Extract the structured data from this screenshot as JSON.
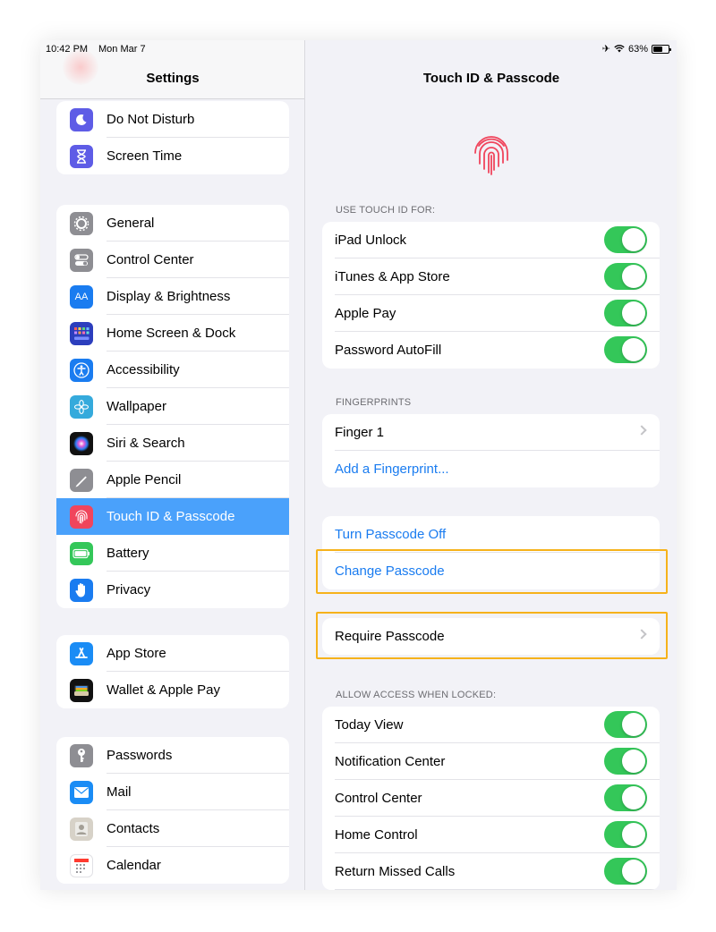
{
  "status": {
    "time": "10:42 PM",
    "date": "Mon Mar 7",
    "battery": "63%",
    "battery_level": 0.63
  },
  "sidebar": {
    "title": "Settings",
    "groups": [
      {
        "items": [
          {
            "label": "Do Not Disturb",
            "icon": "moon-icon",
            "color": "#5e5ce6"
          },
          {
            "label": "Screen Time",
            "icon": "hourglass-icon",
            "color": "#5e5ce6"
          }
        ]
      },
      {
        "items": [
          {
            "label": "General",
            "icon": "gear-icon",
            "color": "#8e8e93"
          },
          {
            "label": "Control Center",
            "icon": "switches-icon",
            "color": "#8e8e93"
          },
          {
            "label": "Display & Brightness",
            "icon": "display-aa-icon",
            "color": "#1a7cf0"
          },
          {
            "label": "Home Screen & Dock",
            "icon": "home-grid-icon",
            "color": "#2c3ebd"
          },
          {
            "label": "Accessibility",
            "icon": "accessibility-icon",
            "color": "#1a7cf0"
          },
          {
            "label": "Wallpaper",
            "icon": "flower-icon",
            "color": "#35aadc"
          },
          {
            "label": "Siri & Search",
            "icon": "siri-icon",
            "color": "#111111"
          },
          {
            "label": "Apple Pencil",
            "icon": "pencil-icon",
            "color": "#8e8e93"
          },
          {
            "label": "Touch ID & Passcode",
            "icon": "fingerprint-icon",
            "color": "#f0455c",
            "selected": true
          },
          {
            "label": "Battery",
            "icon": "battery-icon",
            "color": "#34c759"
          },
          {
            "label": "Privacy",
            "icon": "hand-icon",
            "color": "#1a7cf0"
          }
        ]
      },
      {
        "items": [
          {
            "label": "App Store",
            "icon": "app-store-icon",
            "color": "#1a8cf5"
          },
          {
            "label": "Wallet & Apple Pay",
            "icon": "wallet-icon",
            "color": "#111111"
          }
        ]
      },
      {
        "items": [
          {
            "label": "Passwords",
            "icon": "key-icon",
            "color": "#8e8e93"
          },
          {
            "label": "Mail",
            "icon": "mail-icon",
            "color": "#1a8cf5"
          },
          {
            "label": "Contacts",
            "icon": "contacts-icon",
            "color": "#b9b4a9"
          },
          {
            "label": "Calendar",
            "icon": "calendar-icon",
            "color": "#ffffff"
          }
        ]
      }
    ]
  },
  "detail": {
    "title": "Touch ID & Passcode",
    "use_touch_id_header": "USE TOUCH ID FOR:",
    "use_touch_id": [
      {
        "label": "iPad Unlock",
        "on": true
      },
      {
        "label": "iTunes & App Store",
        "on": true
      },
      {
        "label": "Apple Pay",
        "on": true
      },
      {
        "label": "Password AutoFill",
        "on": true
      }
    ],
    "fingerprints_header": "FINGERPRINTS",
    "finger_1": "Finger 1",
    "add_fingerprint": "Add a Fingerprint...",
    "turn_passcode_off": "Turn Passcode Off",
    "change_passcode": "Change Passcode",
    "require_passcode": "Require Passcode",
    "allow_access_header": "ALLOW ACCESS WHEN LOCKED:",
    "allow_access": [
      {
        "label": "Today View",
        "on": true
      },
      {
        "label": "Notification Center",
        "on": true
      },
      {
        "label": "Control Center",
        "on": true
      },
      {
        "label": "Home Control",
        "on": true
      },
      {
        "label": "Return Missed Calls",
        "on": true
      }
    ]
  },
  "colors": {
    "accent": "#1a7cf0",
    "toggle_on": "#34c759",
    "selection": "#4aa1fb",
    "highlight": "#f6b21b"
  }
}
